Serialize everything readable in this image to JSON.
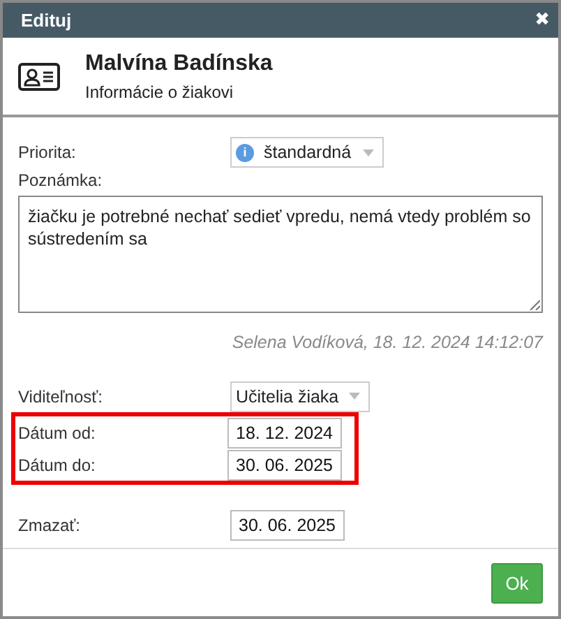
{
  "window": {
    "title": "Edituj",
    "close": "✖"
  },
  "header": {
    "name": "Malvína Badínska",
    "subtitle": "Informácie o žiakovi"
  },
  "priority": {
    "label": "Priorita:",
    "value": "štandardná",
    "icon": "i"
  },
  "note": {
    "label": "Poznámka:",
    "value": "žiačku je potrebné nechať sedieť vpredu, nemá vtedy problém so sústredením sa"
  },
  "author_line": "Selena Vodíková, 18. 12. 2024 14:12:07",
  "groups": [
    {
      "highlighted": false,
      "rows": [
        {
          "kind": "select",
          "label": "Viditeľnosť:",
          "value": "Učitelia žiaka"
        }
      ]
    },
    {
      "highlighted": true,
      "rows": [
        {
          "kind": "date",
          "label": "Dátum od:",
          "value": "18. 12. 2024"
        },
        {
          "kind": "date",
          "label": "Dátum do:",
          "value": "30. 06. 2025"
        }
      ]
    },
    {
      "highlighted": false,
      "rows": [
        {
          "kind": "date",
          "label": "Zmazať:",
          "value": "30. 06. 2025"
        }
      ]
    }
  ],
  "buttons": [
    {
      "label": "Ok"
    }
  ]
}
